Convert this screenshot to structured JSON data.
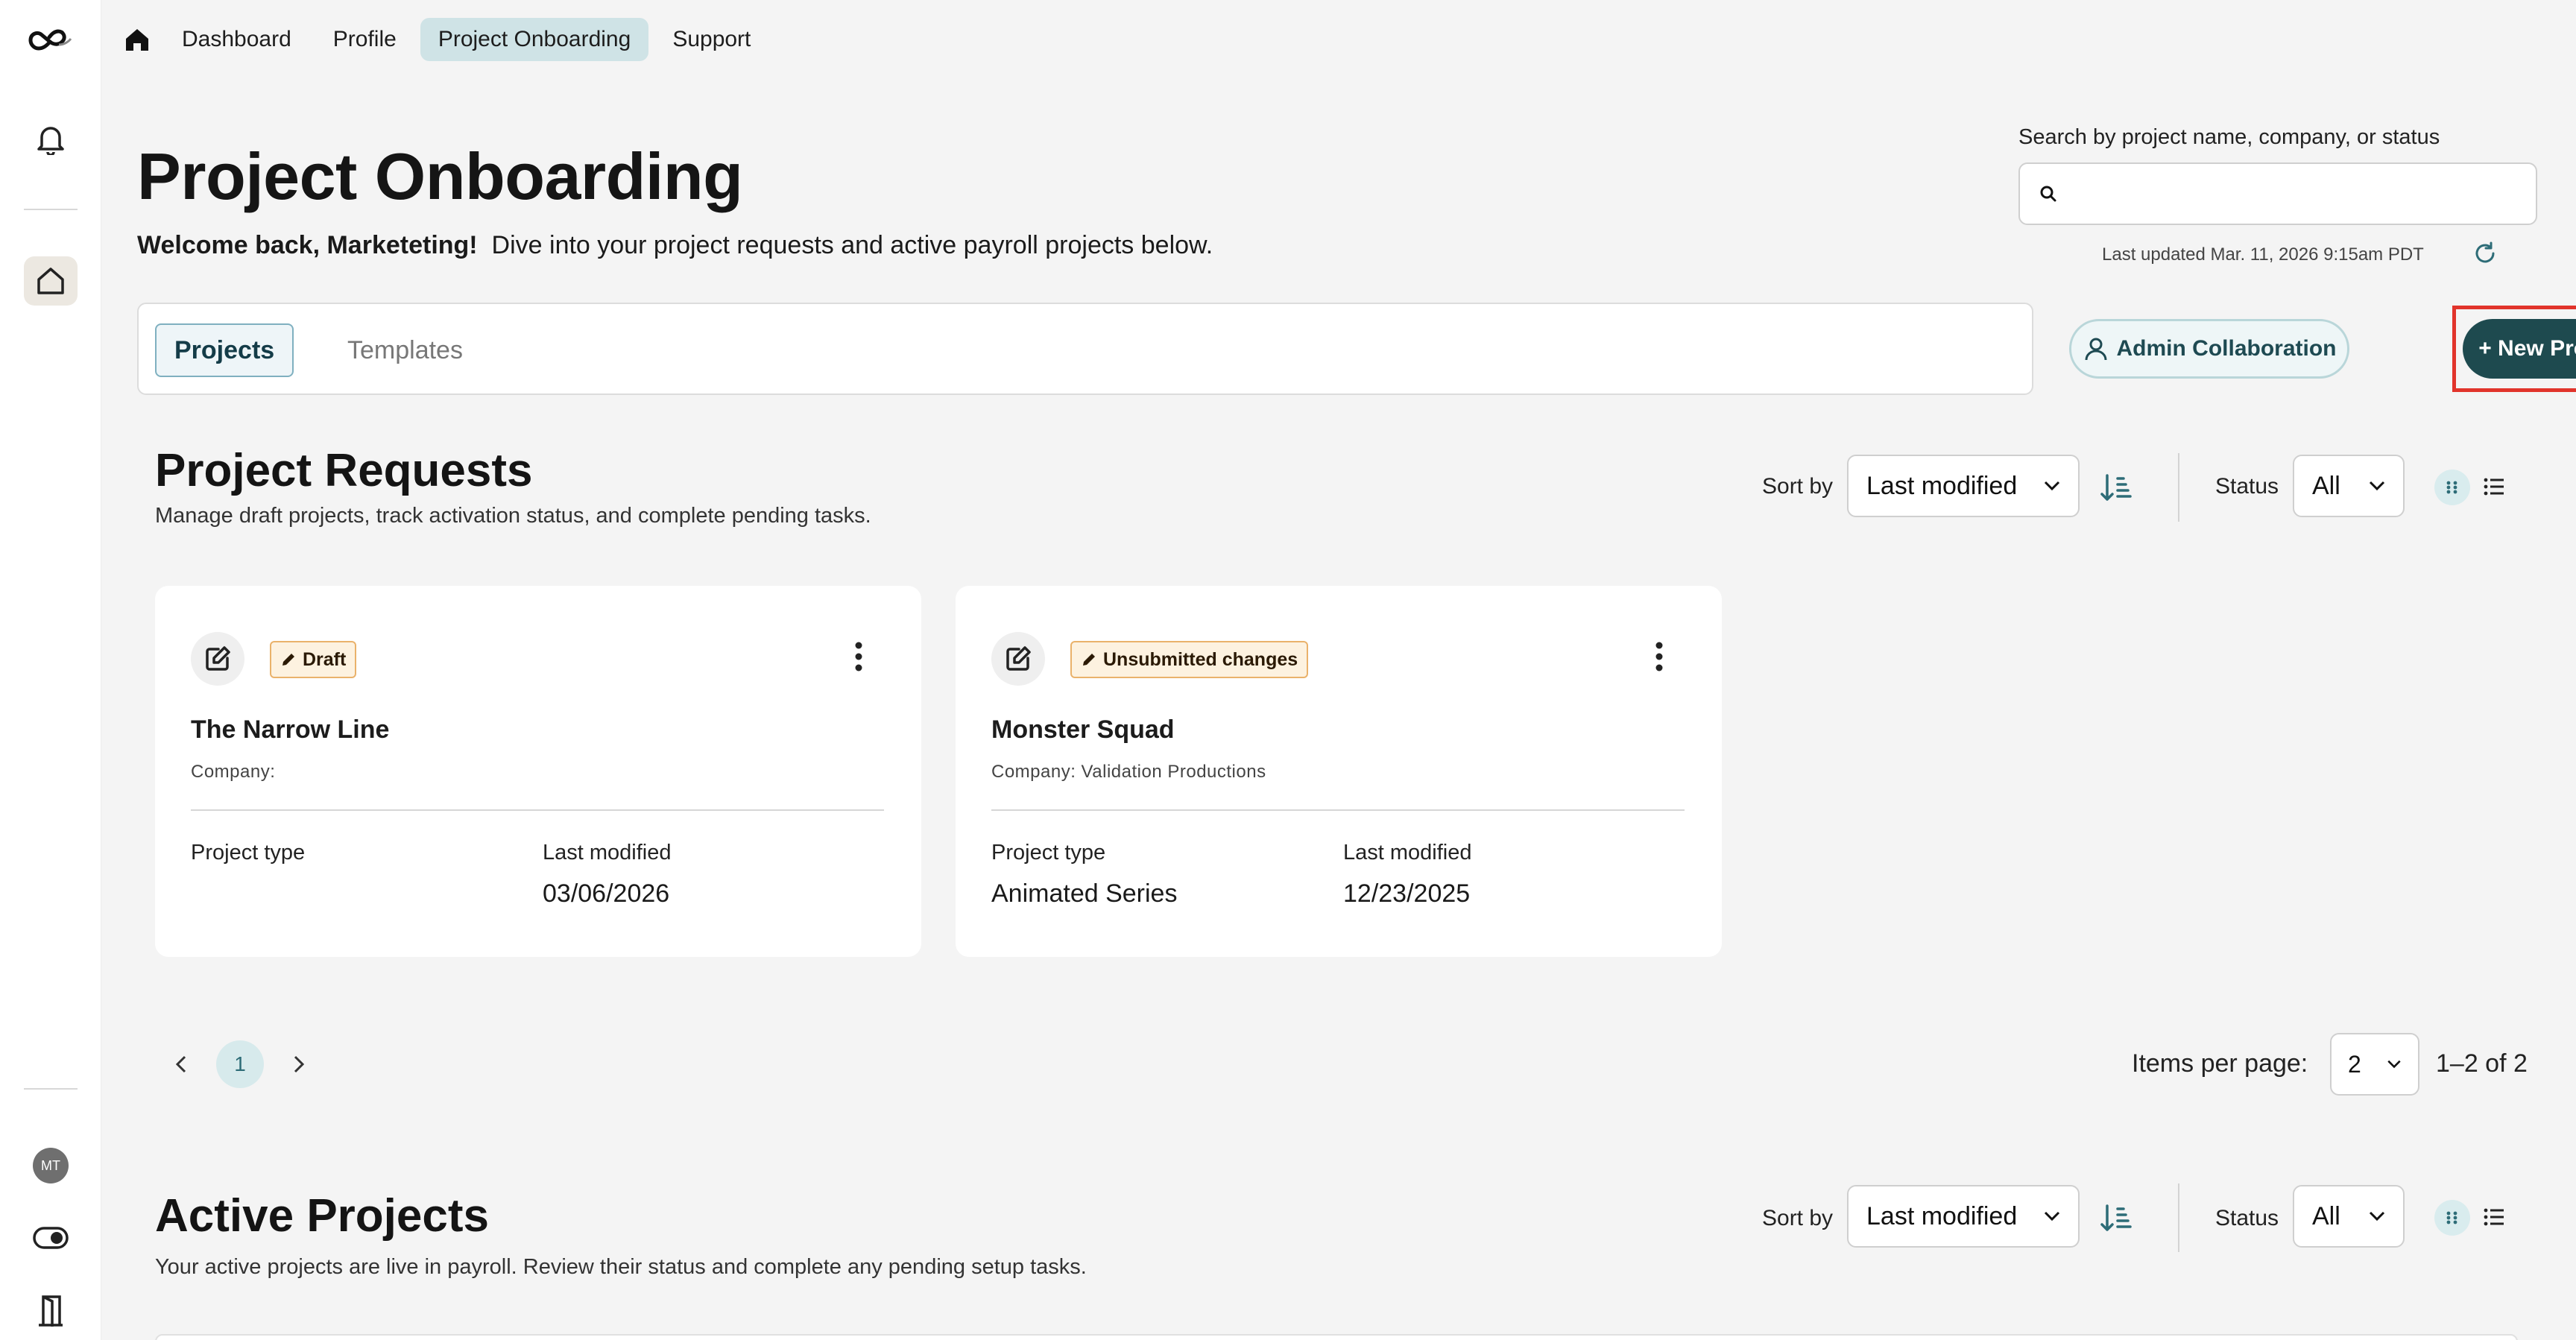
{
  "rail": {
    "logo": "infinity-logo-icon",
    "avatar_initials": "MT"
  },
  "topnav": {
    "items": [
      "Dashboard",
      "Profile",
      "Project Onboarding",
      "Support"
    ],
    "active": "Project Onboarding"
  },
  "header": {
    "title": "Project Onboarding",
    "welcome_bold": "Welcome back, Marketeting!",
    "welcome_rest": "Dive into your project requests and active payroll projects below."
  },
  "search": {
    "label": "Search by project name, company, or status",
    "value": "",
    "placeholder": ""
  },
  "last_updated": "Last updated Mar. 11, 2026 9:15am PDT",
  "tabs": {
    "projects": "Projects",
    "templates": "Templates"
  },
  "actions": {
    "admin_collaboration": "Admin Collaboration",
    "new_project": "+ New Project"
  },
  "requests": {
    "title": "Project Requests",
    "subtitle": "Manage draft projects, track activation status, and complete pending tasks.",
    "sort_label": "Sort by",
    "sort_value": "Last modified",
    "status_label": "Status",
    "status_value": "All",
    "cards": [
      {
        "badge": "Draft",
        "name": "The Narrow Line",
        "company": "Company:",
        "type_label": "Project type",
        "type_value": "",
        "modified_label": "Last modified",
        "modified_value": "03/06/2026"
      },
      {
        "badge": "Unsubmitted changes",
        "name": "Monster Squad",
        "company": "Company:  Validation Productions",
        "type_label": "Project type",
        "type_value": "Animated Series",
        "modified_label": "Last modified",
        "modified_value": "12/23/2025"
      }
    ],
    "pagination": {
      "current_page": "1",
      "items_per_page_label": "Items per page:",
      "items_per_page": "2",
      "range": "1–2 of 2"
    }
  },
  "active": {
    "title": "Active Projects",
    "subtitle": "Your active projects are live in payroll. Review their status and complete any pending setup tasks.",
    "sort_label": "Sort by",
    "sort_value": "Last modified",
    "status_label": "Status",
    "status_value": "All"
  },
  "colors": {
    "accent_dark": "#1e4a4f",
    "active_tab_bg": "#cfe3e6",
    "badge_border": "#eab26b",
    "highlight_frame": "#e1342b"
  }
}
